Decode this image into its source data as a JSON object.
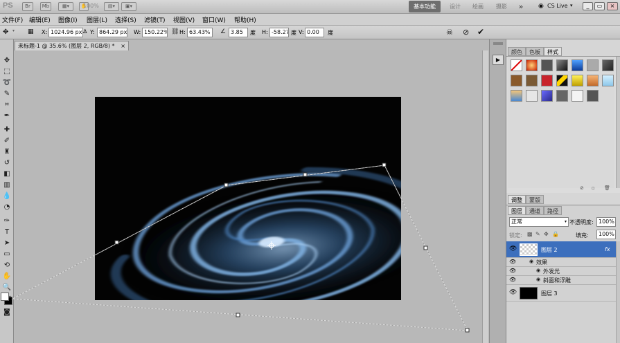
{
  "appbar": {
    "logo": "PS",
    "zoom": "100%",
    "workspaces": [
      "基本功能",
      "设计",
      "绘画",
      "摄影"
    ],
    "more": "»",
    "cslive": "CS Live"
  },
  "menu": [
    "文件(F)",
    "编辑(E)",
    "图像(I)",
    "图层(L)",
    "选择(S)",
    "滤镜(T)",
    "视图(V)",
    "窗口(W)",
    "帮助(H)"
  ],
  "options": {
    "x_label": "X:",
    "x": "1024.96 px",
    "y_label": "Y:",
    "y": "864.29 px",
    "w_label": "W:",
    "w": "150.22%",
    "h_label": "H:",
    "h": "63.43%",
    "angle": "3.85",
    "angle_unit": "度",
    "hskew_label": "H:",
    "hskew": "-58.27",
    "hskew_unit": "度",
    "vskew_label": "V:",
    "vskew": "0.00",
    "vskew_unit": "度"
  },
  "document": {
    "tab_title": "未标题-1 @ 35.6% (图层 2, RGB/8) *",
    "close": "×"
  },
  "panels": {
    "tabs_top": [
      "颜色",
      "色板",
      "样式"
    ],
    "tabs_mid": [
      "调整",
      "蒙版"
    ],
    "tabs_layers": [
      "图层",
      "通道",
      "路径"
    ],
    "blend_mode": "正常",
    "opacity_label": "不透明度:",
    "opacity": "100%",
    "lock_label": "锁定:",
    "fill_label": "填充:",
    "fill": "100%",
    "layers": [
      {
        "name": "图层 2",
        "fx": "fx"
      },
      {
        "effects_label": "效果"
      },
      {
        "effect": "外发光"
      },
      {
        "effect": "斜面和浮雕"
      },
      {
        "name": "图层 3"
      }
    ]
  },
  "colors": {
    "accent": "#3c6fbd",
    "canvas_bg": "#030303",
    "galaxy": "#5d8fc4"
  }
}
